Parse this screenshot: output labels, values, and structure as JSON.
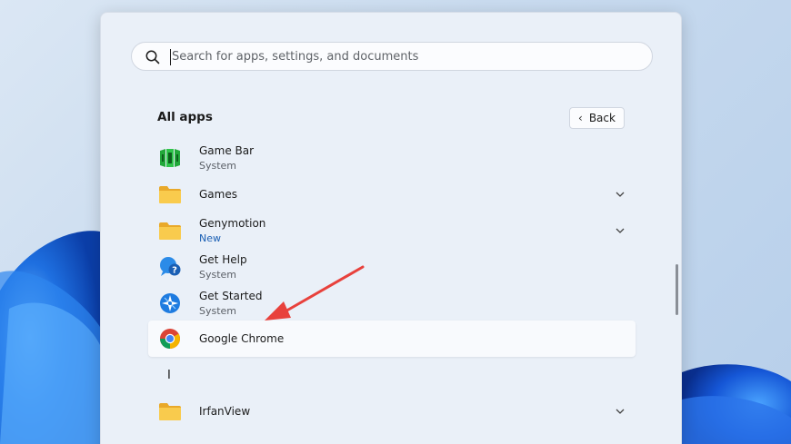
{
  "search": {
    "placeholder": "Search for apps, settings, and documents"
  },
  "all_apps": {
    "title": "All apps",
    "back_label": "Back"
  },
  "apps": [
    {
      "name": "Game Bar",
      "sub": "System",
      "icon": "game-bar-icon",
      "expandable": false
    },
    {
      "name": "Games",
      "sub": "",
      "icon": "folder-icon",
      "expandable": true
    },
    {
      "name": "Genymotion",
      "sub": "New",
      "icon": "folder-icon",
      "expandable": true
    },
    {
      "name": "Get Help",
      "sub": "System",
      "icon": "get-help-icon",
      "expandable": false
    },
    {
      "name": "Get Started",
      "sub": "System",
      "icon": "get-started-icon",
      "expandable": false
    },
    {
      "name": "Google Chrome",
      "sub": "",
      "icon": "chrome-icon",
      "expandable": false,
      "selected": true
    },
    {
      "name": "IrfanView",
      "sub": "",
      "icon": "folder-icon",
      "expandable": true
    }
  ],
  "section_letters": [
    "I"
  ],
  "colors": {
    "arrow": "#e8413c",
    "accent": "#1a5fb4",
    "folder": "#f6c343"
  }
}
